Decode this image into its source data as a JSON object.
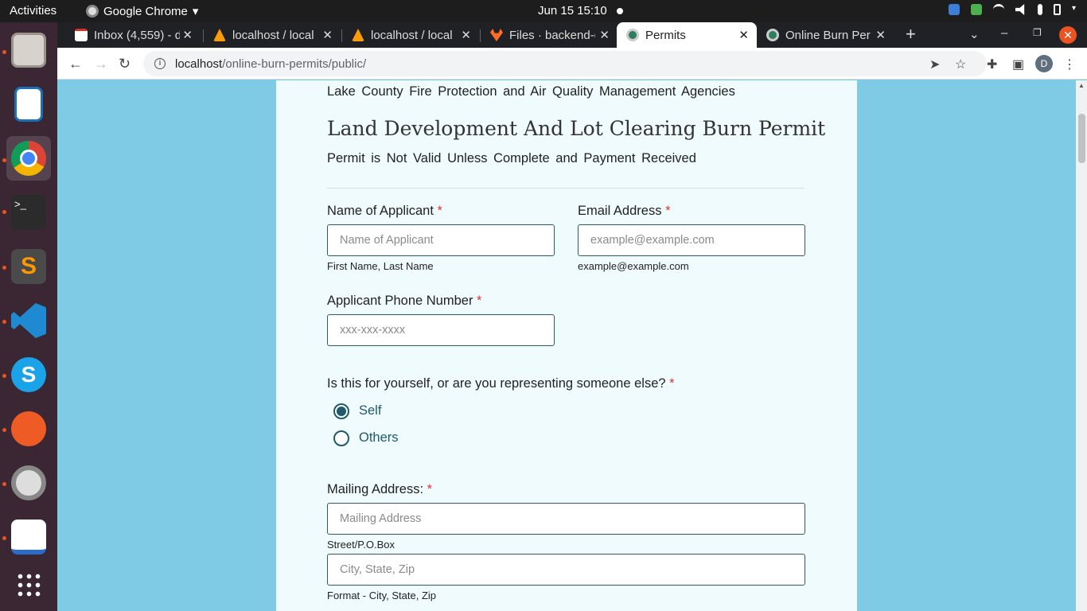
{
  "system": {
    "activities": "Activities",
    "app_name": "Google Chrome",
    "clock": "Jun 15  15:10"
  },
  "browser": {
    "tabs": [
      {
        "title": "Inbox (4,559) - d",
        "active": false
      },
      {
        "title": "localhost / local",
        "active": false
      },
      {
        "title": "localhost / local",
        "active": false
      },
      {
        "title": "Files · backend-c",
        "active": false
      },
      {
        "title": "Permits",
        "active": true
      },
      {
        "title": "Online Burn Per",
        "active": false
      }
    ],
    "url_host": "localhost",
    "url_path": "/online-burn-permits/public/",
    "profile_initial": "D"
  },
  "page": {
    "agency": "Lake County Fire Protection and Air Quality Management Agencies",
    "title": "Land Development And Lot Clearing Burn Permit",
    "subtitle": "Permit is Not Valid Unless Complete and Payment Received",
    "required_mark": "*",
    "name": {
      "label": "Name of Applicant",
      "placeholder": "Name of Applicant",
      "help": "First Name, Last Name"
    },
    "email": {
      "label": "Email Address",
      "placeholder": "example@example.com",
      "help": "example@example.com"
    },
    "phone": {
      "label": "Applicant Phone Number",
      "placeholder": "xxx-xxx-xxxx"
    },
    "representing": {
      "question": "Is this for yourself, or are you representing someone else?",
      "options": [
        {
          "label": "Self",
          "selected": true
        },
        {
          "label": "Others",
          "selected": false
        }
      ]
    },
    "mailing": {
      "label": "Mailing Address:",
      "street_placeholder": "Mailing Address",
      "street_help": "Street/P.O.Box",
      "city_placeholder": "City, State, Zip",
      "city_help": "Format - City, State, Zip"
    }
  }
}
